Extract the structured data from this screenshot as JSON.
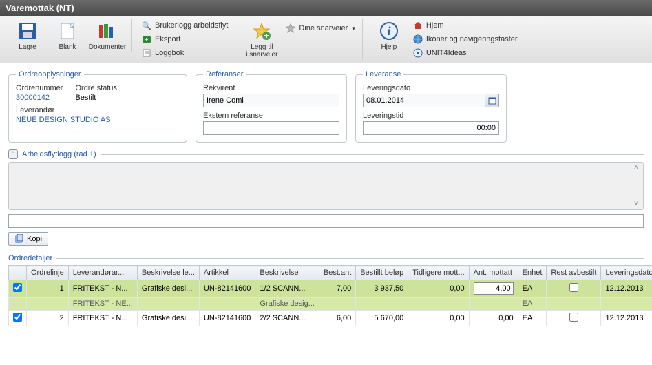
{
  "window": {
    "title": "Varemottak (NT)"
  },
  "toolbar": {
    "lagre": "Lagre",
    "blank": "Blank",
    "dokumenter": "Dokumenter",
    "brukerlogg": "Brukerlogg arbeidsflyt",
    "eksport": "Eksport",
    "loggbok": "Loggbok",
    "legg_til": "Legg til\ni snarveier",
    "dine_snarveier": "Dine snarveier",
    "hjelp": "Hjelp",
    "hjem": "Hjem",
    "ikoner": "Ikoner og navigeringstaster",
    "unit4": "UNIT4Ideas"
  },
  "ordre": {
    "legend": "Ordreopplysninger",
    "ordrenr_label": "Ordrenummer",
    "ordrenr_value": "30000142",
    "status_label": "Ordre status",
    "status_value": "Bestilt",
    "leverandor_label": "Leverandør",
    "leverandor_value": "NEUE DESIGN STUDIO AS"
  },
  "ref": {
    "legend": "Referanser",
    "rekvirent_label": "Rekvirent",
    "rekvirent_value": "Irene Comi",
    "ekstern_label": "Ekstern referanse",
    "ekstern_value": ""
  },
  "lev": {
    "legend": "Leveranse",
    "dato_label": "Leveringsdato",
    "dato_value": "08.01.2014",
    "tid_label": "Leveringstid",
    "tid_value": "00:00"
  },
  "workflow": {
    "title": "Arbeidsflytlogg (rad 1)",
    "kopi": "Kopi"
  },
  "details": {
    "legend": "Ordredetaljer",
    "columns": [
      "",
      "Ordrelinje",
      "Leverandørar...",
      "Beskrivelse le...",
      "Artikkel",
      "Beskrivelse",
      "Best.ant",
      "Bestillt beløp",
      "Tidligere mott...",
      "Ant. mottatt",
      "Enhet",
      "Rest avbestilt",
      "Leveringsdato",
      ""
    ],
    "rows": [
      {
        "checked": true,
        "linje": "1",
        "levart": "FRITEKST - N...",
        "levart_sub": "FRITEKST - NE...",
        "beskriv_le": "Grafiske desi...",
        "beskriv_le_sub": "",
        "artikkel": "UN-82141600",
        "beskriv": "1/2 SCANN...",
        "beskriv_sub": "Grafiske desig...",
        "best_ant": "7,00",
        "belop": "3 937,50",
        "tidl": "0,00",
        "mottatt_input": "4,00",
        "enhet": "EA",
        "enhet_sub": "EA",
        "rest_checked": false,
        "dato": "12.12.2013",
        "selected": true
      },
      {
        "checked": true,
        "linje": "2",
        "levart": "FRITEKST - N...",
        "beskriv_le": "Grafiske desi...",
        "artikkel": "UN-82141600",
        "beskriv": "2/2 SCANN...",
        "best_ant": "6,00",
        "belop": "5 670,00",
        "tidl": "0,00",
        "mottatt": "0,00",
        "enhet": "EA",
        "rest_checked": false,
        "dato": "12.12.2013",
        "selected": false
      }
    ]
  }
}
